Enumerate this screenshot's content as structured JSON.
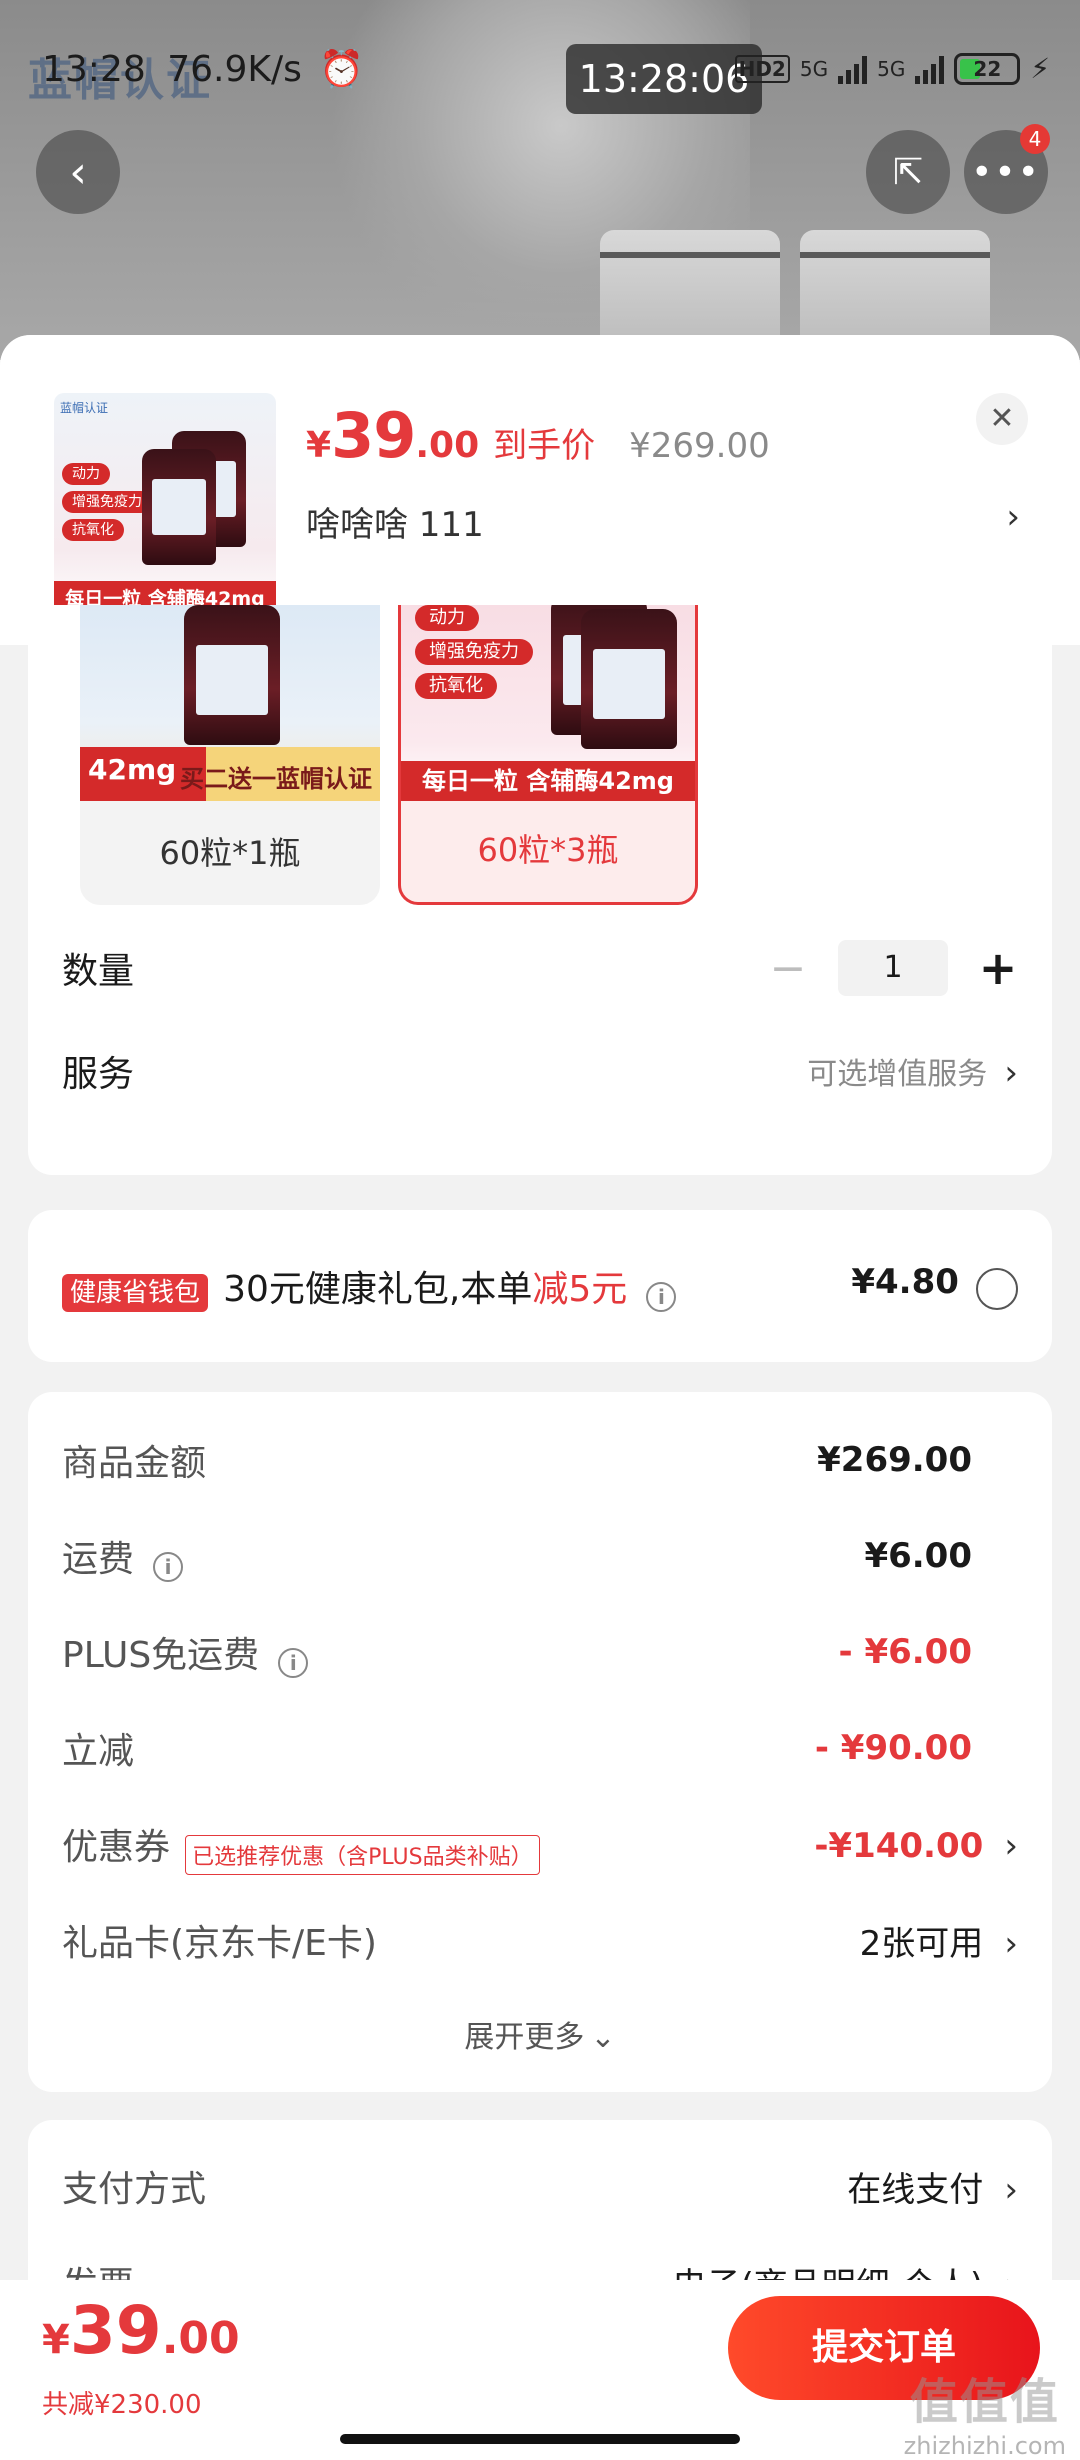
{
  "status_bar": {
    "time": "13:28",
    "net_speed": "76.9K/s",
    "overlay_time": "13:28:06",
    "hd_label": "HD2",
    "sig1": "5G",
    "sig2": "5G",
    "battery": "22"
  },
  "background": {
    "brand_logo": "蓝帽认证",
    "more_badge": "4"
  },
  "product": {
    "thumb_logo": "蓝帽认证",
    "thumb_pills": [
      "动力",
      "增强免疫力",
      "抗氧化"
    ],
    "thumb_band": "每日一粒 含辅酶42mg",
    "price_currency": "¥",
    "price_int": "39",
    "price_dec": ".00",
    "price_tag": "到手价",
    "price_original": "¥269.00",
    "variant_text": "啥啥啥  111"
  },
  "options": [
    {
      "label": "60粒*1瓶",
      "strip_a": "42mg",
      "strip_b": "买二送一蓝帽认证",
      "selected": false
    },
    {
      "label": "60粒*3瓶",
      "pills": [
        "动力",
        "增强免疫力",
        "抗氧化"
      ],
      "band": "每日一粒 含辅酶42mg",
      "selected": true
    }
  ],
  "quantity": {
    "label": "数量",
    "value": "1"
  },
  "service": {
    "label": "服务",
    "hint": "可选增值服务"
  },
  "wallet": {
    "tag": "健康省钱包",
    "text": "30元健康礼包,本单",
    "highlight": "减5元",
    "price": "¥4.80"
  },
  "summary": {
    "rows": [
      {
        "label": "商品金额",
        "value": "¥269.00"
      },
      {
        "label": "运费",
        "value": "¥6.00"
      },
      {
        "label": "PLUS免运费",
        "value": "- ¥6.00"
      },
      {
        "label": "立减",
        "value": "- ¥90.00"
      },
      {
        "label": "优惠券",
        "tag": "已选推荐优惠（含PLUS品类补贴）",
        "value": "-¥140.00"
      },
      {
        "label": "礼品卡(京东卡/E卡)",
        "value": "2张可用"
      }
    ],
    "expand": "展开更多"
  },
  "payment": {
    "method_label": "支付方式",
    "method_value": "在线支付",
    "invoice_label": "发票",
    "invoice_value": "电子(商品明细-个人)"
  },
  "bottom": {
    "total_currency": "¥",
    "total_int": "39",
    "total_dec": ".00",
    "reduced": "共减¥230.00",
    "submit": "提交订单"
  },
  "watermark": {
    "big": "值值值",
    "small": "zhizhizhi.com"
  },
  "colors": {
    "accent": "#e4393c",
    "submit_start": "#ff4a2a",
    "submit_end": "#e8141b"
  }
}
